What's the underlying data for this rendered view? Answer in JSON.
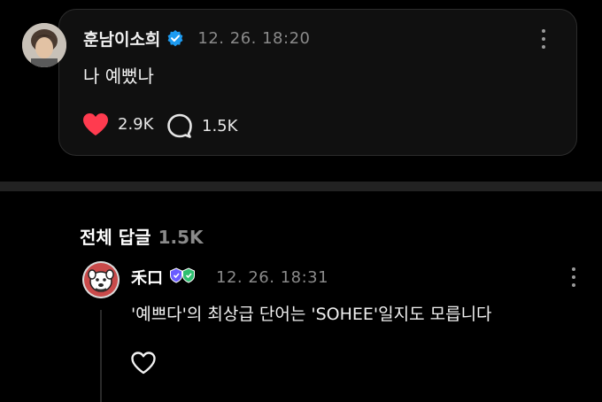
{
  "post": {
    "author": "훈남이소희",
    "timestamp": "12. 26. 18:20",
    "text": "나 예뻤나",
    "likes": "2.9K",
    "comments": "1.5K"
  },
  "replies_section": {
    "title": "전체 답글",
    "count": "1.5K"
  },
  "reply": {
    "author": "禾口",
    "timestamp": "12. 26. 18:31",
    "text": "'예쁘다'의 최상급 단어는 'SOHEE'일지도 모릅니다"
  },
  "colors": {
    "background": "#000000",
    "card": "#101010",
    "like_red": "#ff3b4f",
    "verified_blue": "#1d9bf0",
    "badge_green": "#2fbf71",
    "badge_purple": "#6a5cff"
  },
  "icons": [
    "verified-badge-icon",
    "more-icon",
    "heart-icon",
    "comment-bubble-icon"
  ]
}
